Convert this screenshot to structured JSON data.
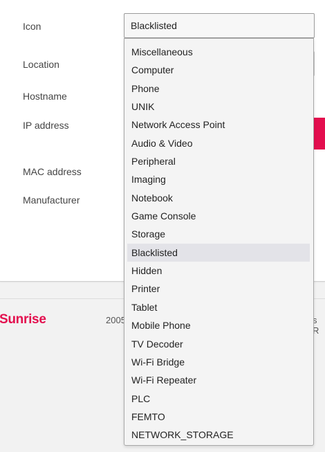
{
  "form": {
    "labels": {
      "icon": "Icon",
      "location": "Location",
      "hostname": "Hostname",
      "ip_address": "IP address",
      "mac_address": "MAC address",
      "manufacturer": "Manufacturer"
    },
    "icon_select": {
      "value": "Blacklisted",
      "options": [
        "Miscellaneous",
        "Computer",
        "Phone",
        "UNIK",
        "Network Access Point",
        "Audio & Video",
        "Peripheral",
        "Imaging",
        "Notebook",
        "Game Console",
        "Storage",
        "Blacklisted",
        "Hidden",
        "Printer",
        "Tablet",
        "Mobile Phone",
        "TV Decoder",
        "Wi-Fi Bridge",
        "Wi-Fi Repeater",
        "PLC",
        "FEMTO",
        "NETWORK_STORAGE"
      ],
      "selected_index": 11
    }
  },
  "footer": {
    "logo": "Sunrise",
    "year_fragment": "2005",
    "rights_fragment": "s R"
  },
  "colors": {
    "brand": "#e30e4e",
    "highlight": "#e3e3e8"
  }
}
